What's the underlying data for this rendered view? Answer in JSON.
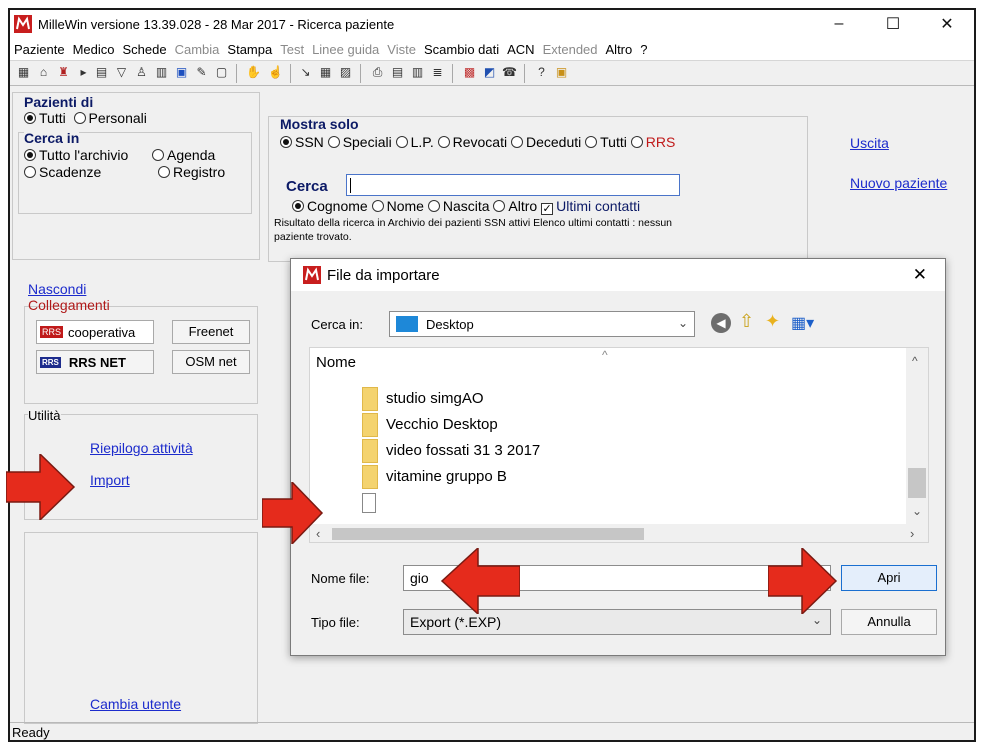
{
  "window": {
    "title": "MilleWin versione 13.39.028 - 28 Mar 2017 - Ricerca paziente",
    "controls": [
      "–",
      "☐",
      "✕"
    ]
  },
  "menu": {
    "items": [
      {
        "label": "Paziente",
        "enabled": true
      },
      {
        "label": "Medico",
        "enabled": true
      },
      {
        "label": "Schede",
        "enabled": true
      },
      {
        "label": "Cambia",
        "enabled": false
      },
      {
        "label": "Stampa",
        "enabled": true
      },
      {
        "label": "Test",
        "enabled": false
      },
      {
        "label": "Linee guida",
        "enabled": false
      },
      {
        "label": "Viste",
        "enabled": false
      },
      {
        "label": "Scambio dati",
        "enabled": true
      },
      {
        "label": "ACN",
        "enabled": true
      },
      {
        "label": "Extended",
        "enabled": false
      },
      {
        "label": "Altro",
        "enabled": true
      },
      {
        "label": "?",
        "enabled": true
      }
    ]
  },
  "pazienti_di": {
    "label": "Pazienti di",
    "options": [
      {
        "label": "Tutti",
        "selected": true
      },
      {
        "label": "Personali",
        "selected": false
      }
    ]
  },
  "cerca_in": {
    "label": "Cerca in",
    "options": [
      {
        "label": "Tutto l'archivio",
        "selected": true
      },
      {
        "label": "Agenda",
        "selected": false
      },
      {
        "label": "Scadenze",
        "selected": false
      },
      {
        "label": "Registro",
        "selected": false
      }
    ]
  },
  "mostra_solo": {
    "label": "Mostra solo",
    "options": [
      {
        "label": "SSN",
        "selected": true
      },
      {
        "label": "Speciali",
        "selected": false
      },
      {
        "label": "L.P.",
        "selected": false
      },
      {
        "label": "Revocati",
        "selected": false
      },
      {
        "label": "Deceduti",
        "selected": false
      },
      {
        "label": "Tutti",
        "selected": false
      },
      {
        "label": "RRS",
        "selected": false
      }
    ]
  },
  "cerca": {
    "label": "Cerca",
    "value": "",
    "options": [
      {
        "label": "Cognome",
        "selected": true
      },
      {
        "label": "Nome",
        "selected": false
      },
      {
        "label": "Nascita",
        "selected": false
      },
      {
        "label": "Altro",
        "selected": false
      }
    ],
    "ultimi_contatti": "Ultimi contatti",
    "result_line1": "Risultato della ricerca in Archivio dei pazienti SSN attivi  Elenco ultimi contatti : nessun",
    "result_line2": "paziente trovato."
  },
  "links": {
    "uscita": "Uscita",
    "nuovo_paziente": "Nuovo paziente",
    "nascondi": "Nascondi",
    "riepilogo": "Riepilogo attività",
    "import": "Import",
    "cambia_utente": "Cambia utente"
  },
  "collegamenti": {
    "label": "Collegamenti",
    "cooperativa_badge": "RRS",
    "cooperativa": "cooperativa",
    "freenet": "Freenet",
    "rrsnet_badge": "RRS",
    "rrsnet": "RRS NET",
    "osmnet": "OSM net"
  },
  "utilita": {
    "label": "Utilità"
  },
  "status": {
    "text": "Ready"
  },
  "dialog": {
    "title": "File da importare",
    "cerca_in_label": "Cerca in:",
    "location": "Desktop",
    "column_header": "Nome",
    "files": [
      "studio simgAO",
      "Vecchio Desktop",
      "video fossati 31 3 2017",
      "vitamine gruppo B"
    ],
    "nome_file_label": "Nome file:",
    "nome_file_value": "gio",
    "tipo_file_label": "Tipo file:",
    "tipo_file_value": "Export (*.EXP)",
    "open_button": "Apri",
    "cancel_button": "Annulla"
  },
  "colors": {
    "accent_red": "#e52b1c",
    "link_blue": "#1c2bcc",
    "label_navy": "#0c1a66",
    "rrs_red": "#c01a1a"
  }
}
